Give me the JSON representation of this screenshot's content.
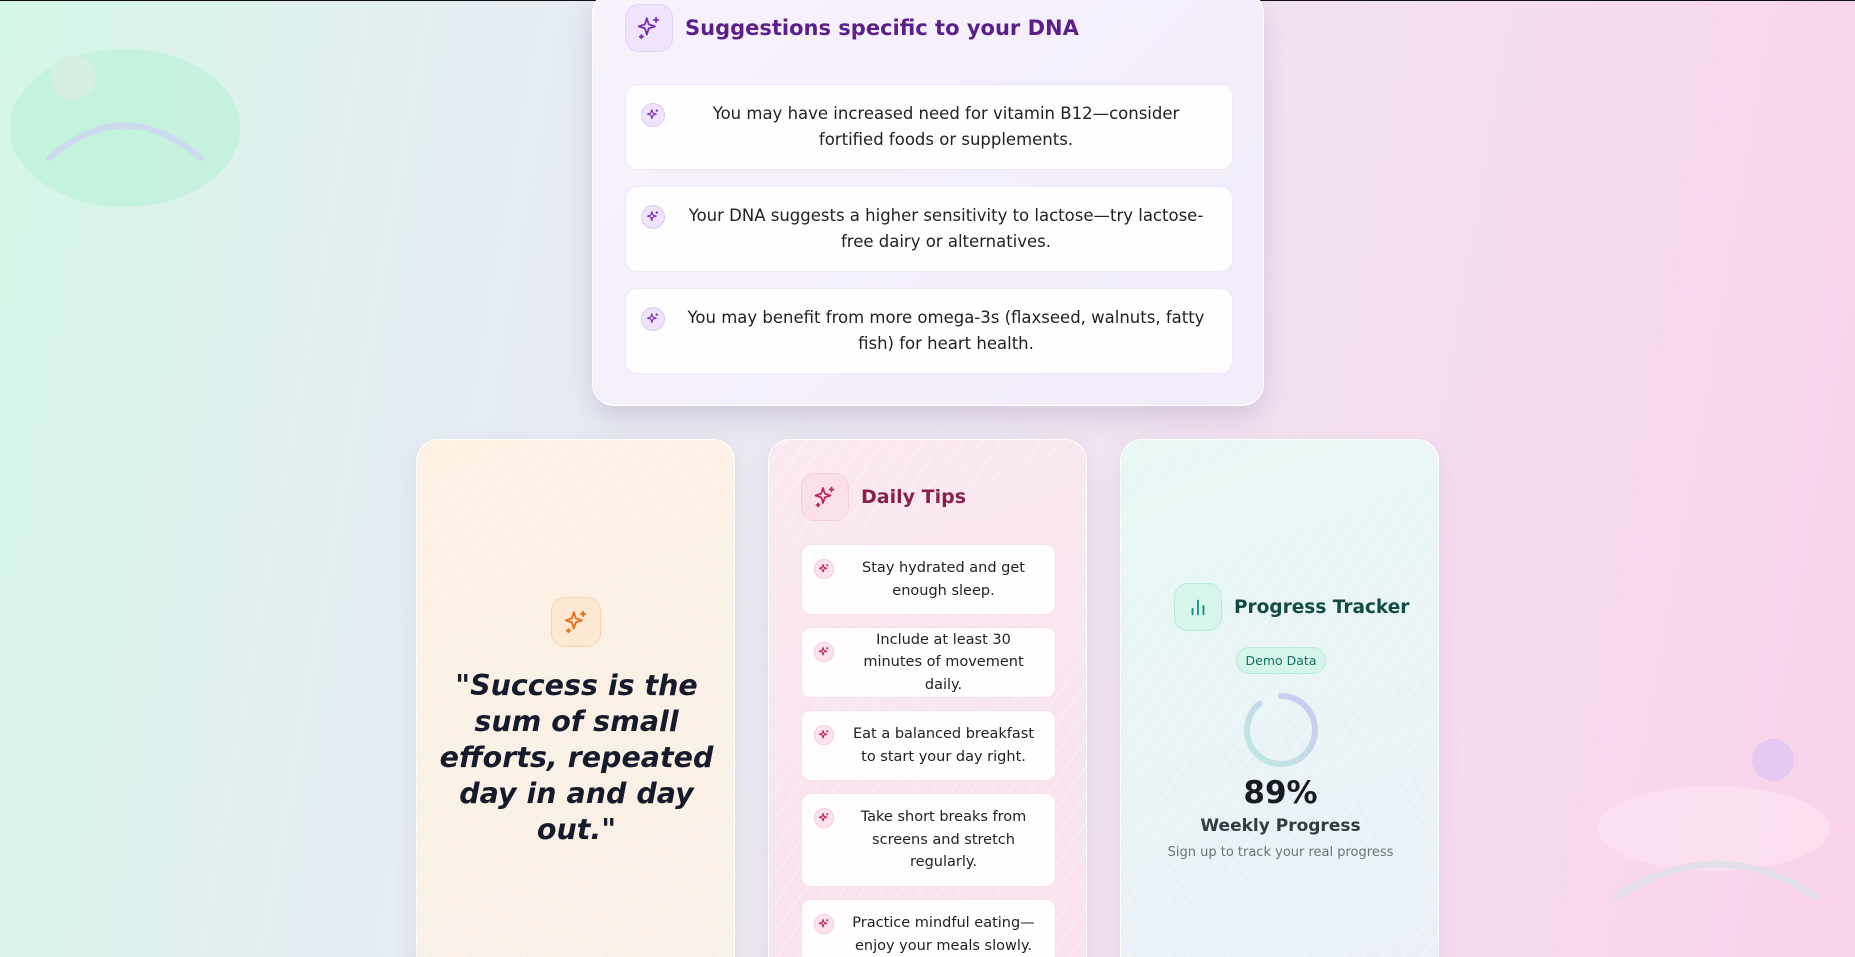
{
  "dna_card": {
    "title": "Suggestions specific to your DNA",
    "icon": "sparkles-icon",
    "suggestions": [
      "You may have increased need for vitamin B12—consider fortified foods or supplements.",
      "Your DNA suggests a higher sensitivity to lactose—try lactose-free dairy or alternatives.",
      "You may benefit from more omega-3s (flaxseed, walnuts, fatty fish) for heart health."
    ]
  },
  "quote_card": {
    "icon": "sparkles-icon",
    "quote": "\"Success is the sum of small efforts, repeated day in and day out.\""
  },
  "tips_card": {
    "title": "Daily Tips",
    "icon": "sparkles-icon",
    "tips": [
      "Stay hydrated and get enough sleep.",
      "Include at least 30 minutes of movement daily.",
      "Eat a balanced breakfast to start your day right.",
      "Take short breaks from screens and stretch regularly.",
      "Practice mindful eating—enjoy your meals slowly."
    ]
  },
  "progress_card": {
    "title": "Progress Tracker",
    "icon": "bar-chart-icon",
    "badge": "Demo Data",
    "percent": "89%",
    "progress_fraction": 0.89,
    "label": "Weekly Progress",
    "note": "Sign up to track your real progress"
  },
  "colors": {
    "dna_accent": "#5b1f8a",
    "tips_accent": "#8a1f4b",
    "progress_accent": "#124b45",
    "quote_icon": "#e8731a"
  }
}
